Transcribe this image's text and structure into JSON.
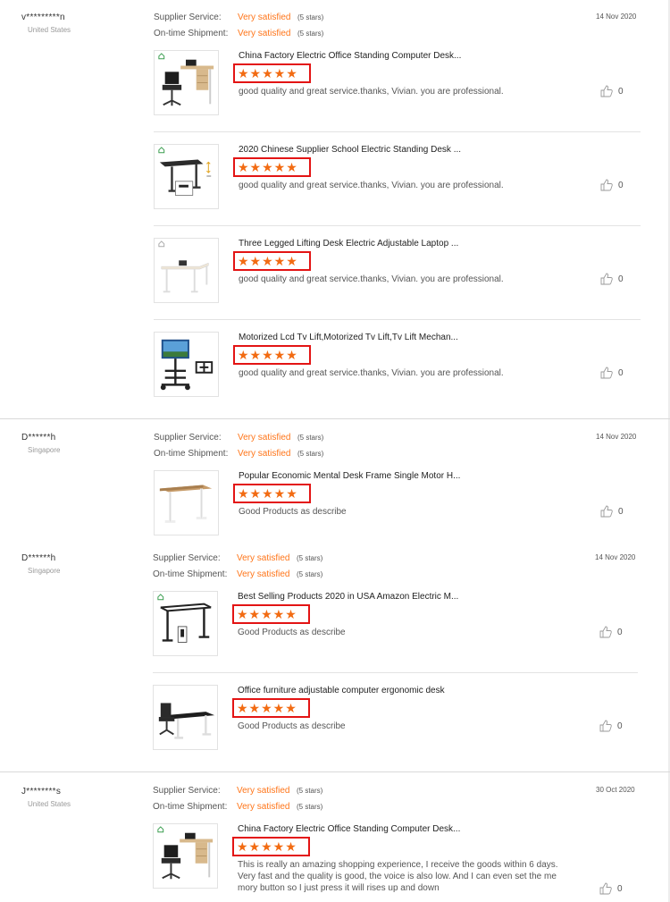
{
  "labels": {
    "supplier_service": "Supplier Service:",
    "on_time_shipment": "On-time Shipment:"
  },
  "reviews": [
    {
      "buyer": "v*********n",
      "country": "United States",
      "date": "14 Nov 2020",
      "supplier_rating": "Very satisfied",
      "supplier_stars": "(5 stars)",
      "shipment_rating": "Very satisfied",
      "shipment_stars": "(5 stars)",
      "products": [
        {
          "title": "China Factory Electric Office Standing Computer Desk...",
          "stars": "★★★★★",
          "rating": 5,
          "comment": "good quality and great service.thanks, Vivian. you are professional.",
          "likes": "0"
        },
        {
          "title": "2020 Chinese Supplier School Electric Standing Desk ...",
          "stars": "★★★★★",
          "rating": 5,
          "comment": "good quality and great service.thanks, Vivian. you are professional.",
          "likes": "0"
        },
        {
          "title": "Three Legged Lifting Desk Electric Adjustable Laptop ...",
          "stars": "★★★★★",
          "rating": 5,
          "comment": "good quality and great service.thanks, Vivian. you are professional.",
          "likes": "0"
        },
        {
          "title": "Motorized Lcd Tv Lift,Motorized Tv Lift,Tv Lift Mechan...",
          "stars": "★★★★★",
          "rating": 5,
          "comment": "good quality and great service.thanks, Vivian. you are professional.",
          "likes": "0"
        }
      ]
    },
    {
      "buyer": "D******h",
      "country": "Singapore",
      "date": "14 Nov 2020",
      "supplier_rating": "Very satisfied",
      "supplier_stars": "(5 stars)",
      "shipment_rating": "Very satisfied",
      "shipment_stars": "(5 stars)",
      "products": [
        {
          "title": "Popular Economic Mental Desk Frame Single Motor H...",
          "stars": "★★★★★",
          "rating": 5,
          "comment": "Good Products as describe",
          "likes": "0"
        }
      ]
    },
    {
      "buyer": "D******h",
      "country": "Singapore",
      "date": "14 Nov 2020",
      "supplier_rating": "Very satisfied",
      "supplier_stars": "(5 stars)",
      "shipment_rating": "Very satisfied",
      "shipment_stars": "(5 stars)",
      "products": [
        {
          "title": "Best Selling Products 2020 in USA Amazon Electric M...",
          "stars": "★★★★★",
          "rating": 5,
          "comment": "Good Products as describe",
          "likes": "0"
        },
        {
          "title": "Office furniture adjustable computer ergonomic desk",
          "stars": "★★★★★",
          "rating": 5,
          "comment": "Good Products as describe",
          "likes": "0"
        }
      ]
    },
    {
      "buyer": "J********s",
      "country": "United States",
      "date": "30 Oct 2020",
      "supplier_rating": "Very satisfied",
      "supplier_stars": "(5 stars)",
      "shipment_rating": "Very satisfied",
      "shipment_stars": "(5 stars)",
      "products": [
        {
          "title": "China Factory Electric Office Standing Computer Desk...",
          "stars": "★★★★★",
          "rating": 5,
          "comment": "This is really an amazing shopping experience, I receive the goods within 6 days. Very fast and the quality is good, the voice is also low. And I can even set the me mory button so I just press it will rises up and down",
          "likes": "0"
        }
      ]
    }
  ],
  "icons": {
    "like": "thumbs-up-icon",
    "badge": "home-badge-icon"
  },
  "colors": {
    "rating_text": "#ff7519",
    "stars": "#f26b12",
    "highlight_box": "#e31414"
  }
}
